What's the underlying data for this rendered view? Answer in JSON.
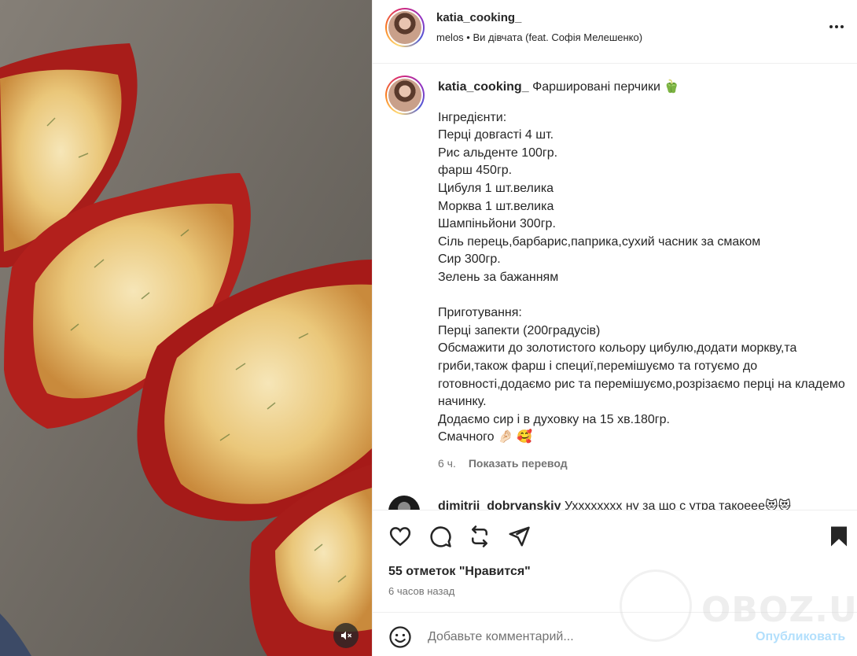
{
  "header": {
    "username": "katia_cooking_",
    "audio": "melos • Ви дівчата (feat. Софія Мелешенко)"
  },
  "caption": {
    "username": "katia_cooking_",
    "title": "Фаршировані перчики 🫑",
    "body": "Інгредієнти:\nПерці довгасті 4 шт.\nРис альденте 100гр.\nфарш 450гр.\nЦибуля 1 шт.велика\nМорква 1 шт.велика\nШампіньйони 300гр.\nСіль перець,барбарис,паприка,сухий часник за смаком\nСир 300гр.\nЗелень за бажанням\n\nПриготування:\nПерці запекти (200градусів)\nОбсмажити до золотистого кольору цибулю,додати моркву,та гриби,також фарш і специї,перемішуємо та готуємо до готовності,додаємо рис та перемішуємо,розрізаємо перці на кладемо начинку.\nДодаємо сир і в духовку на 15 хв.180гр.\nСмачного 🤌🏻 🥰",
    "time": "6 ч.",
    "translate": "Показать перевод"
  },
  "comment": {
    "username": "dimitrii_dobrvanskiy",
    "text": "Ухххххххх ну за що с утра такоеее😻😻"
  },
  "actions": {
    "likes": "55 отметок \"Нравится\"",
    "time_ago": "6 часов назад"
  },
  "comment_box": {
    "placeholder": "Добавьте комментарий...",
    "post_label": "Опубликовать"
  },
  "watermark": {
    "text": "OBOZ.UA"
  },
  "icons": {
    "more": "more-icon",
    "like": "heart-icon",
    "comment": "comment-icon",
    "share": "repost-icon",
    "send": "send-icon",
    "save": "bookmark-icon",
    "emoji": "emoji-icon",
    "mute": "mute-icon"
  },
  "colors": {
    "link_disabled": "#b2dffc",
    "text": "#262626",
    "secondary": "#737373"
  }
}
